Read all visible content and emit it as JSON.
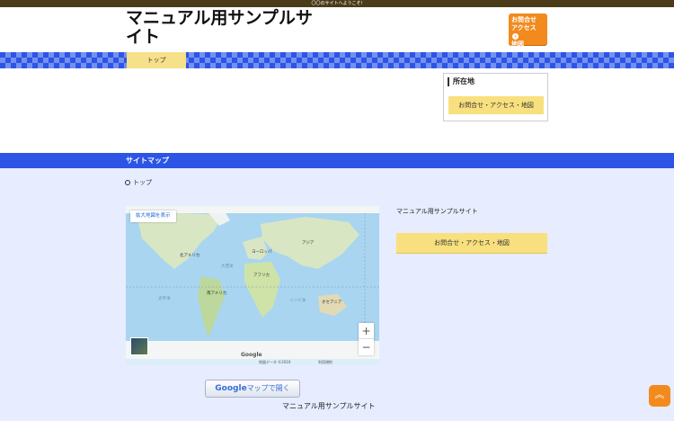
{
  "header": {
    "welcome": "〇〇のサイトへようこそ!",
    "site_title": "マニュアル用サンプルサイト",
    "contact_button": "お問合せアクセス地図"
  },
  "nav": {
    "top": "トップ"
  },
  "sidebar": {
    "title": "所在地",
    "button": "お問合せ・アクセス・地図"
  },
  "sitemap": {
    "heading": "サイトマップ",
    "items": [
      "トップ"
    ]
  },
  "map": {
    "expand": "拡大地図を表示",
    "zoom_in": "+",
    "zoom_out": "−",
    "google": "Google",
    "scale": "0 km",
    "terms": "地図データ ©2019",
    "report": "利用規約",
    "labels": {
      "north_america": "北アメリカ",
      "europe": "ヨーロッパ",
      "asia": "アジア",
      "africa": "アフリカ",
      "south_america": "南アメリカ",
      "oceania": "オセアニア",
      "atlantic": "大西洋",
      "pacific": "太平洋",
      "indian": "インド洋"
    }
  },
  "address": {
    "name": "マニュアル用サンプルサイト",
    "button": "お問合せ・アクセス・地図"
  },
  "gmap_button": {
    "brand": "Google",
    "label": "マップで開く"
  },
  "footer": {
    "name": "マニュアル用サンプルサイト"
  },
  "pagetop": "︽"
}
